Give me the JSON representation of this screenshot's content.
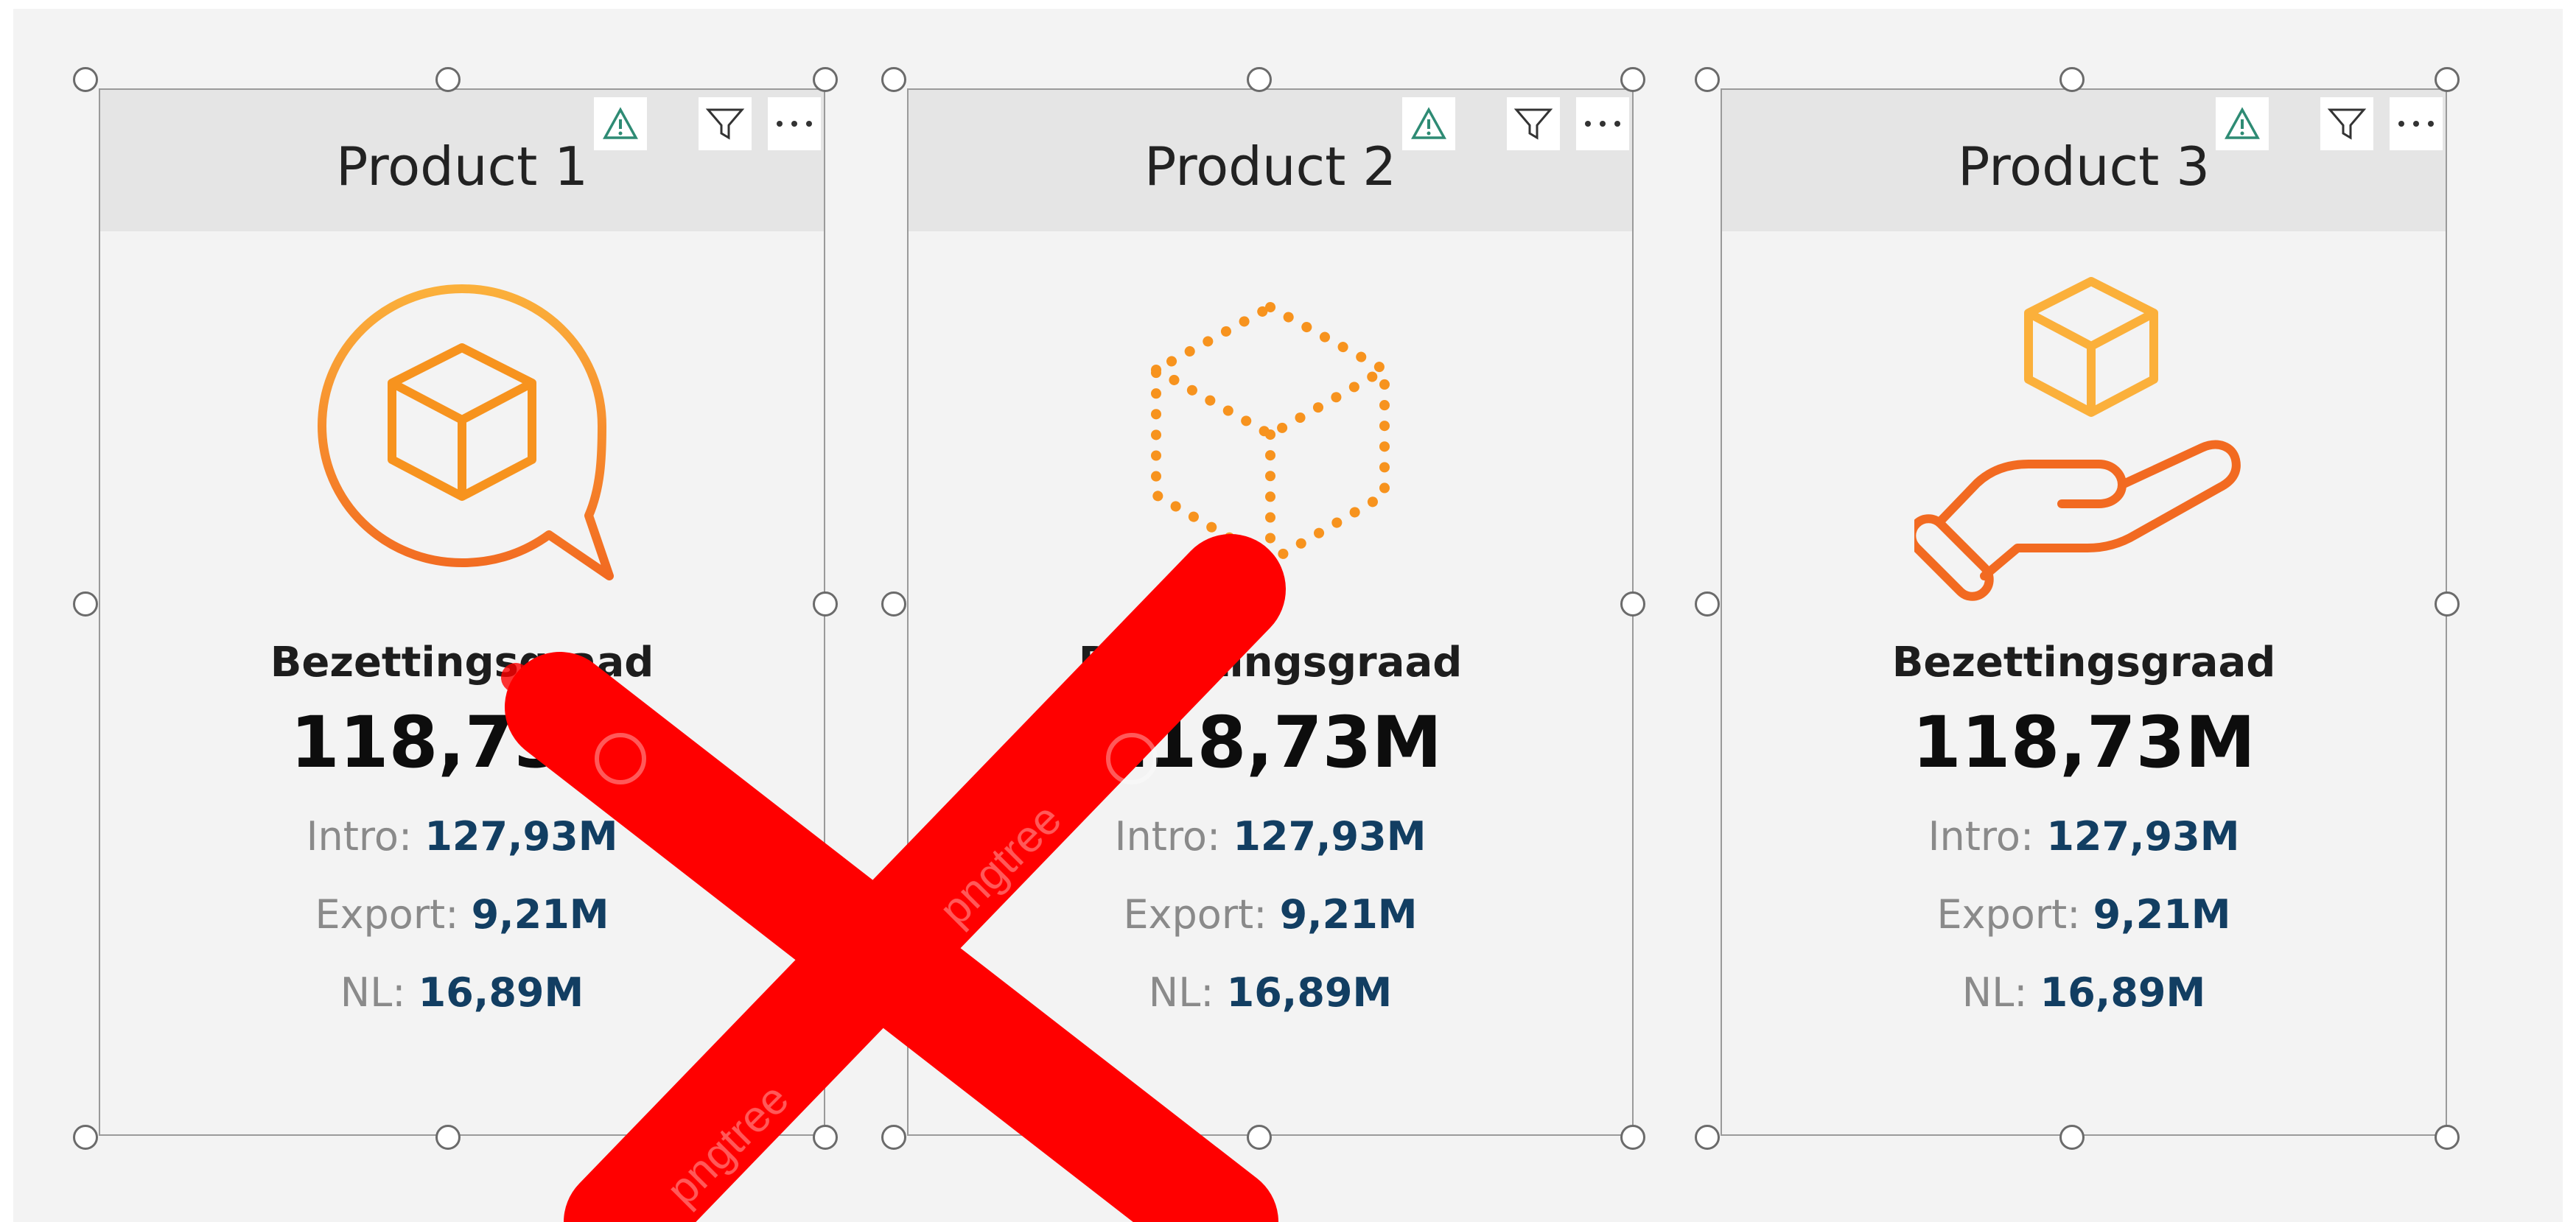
{
  "visuals": [
    {
      "title": "Product 1",
      "icon": "chat-bubble-cube-icon",
      "kpi_label": "Bezettingsgraad",
      "kpi_value": "118,73M",
      "rows": [
        {
          "label": "Intro:",
          "value": "127,93M"
        },
        {
          "label": "Export:",
          "value": "9,21M"
        },
        {
          "label": "NL:",
          "value": "16,89M"
        }
      ]
    },
    {
      "title": "Product 2",
      "icon": "dotted-cube-icon",
      "kpi_label": "Bezettingsgraad",
      "kpi_value": "118,73M",
      "rows": [
        {
          "label": "Intro:",
          "value": "127,93M"
        },
        {
          "label": "Export:",
          "value": "9,21M"
        },
        {
          "label": "NL:",
          "value": "16,89M"
        }
      ]
    },
    {
      "title": "Product 3",
      "icon": "hand-holding-cube-icon",
      "kpi_label": "Bezettingsgraad",
      "kpi_value": "118,73M",
      "rows": [
        {
          "label": "Intro:",
          "value": "127,93M"
        },
        {
          "label": "Export:",
          "value": "9,21M"
        },
        {
          "label": "NL:",
          "value": "16,89M"
        }
      ]
    }
  ],
  "header_buttons": [
    "warning-icon",
    "filter-icon",
    "more-options-icon"
  ],
  "overlay": {
    "icon": "red-x-cross-icon",
    "watermark": "pngtree"
  },
  "colors": {
    "accent_orange": "#f7931e",
    "accent_yellow": "#fbb03b",
    "accent_deep_orange": "#f26a21",
    "value_blue": "#123e62",
    "header_bg": "#e5e5e5",
    "canvas_bg": "#f3f3f3",
    "cross_red": "#ff0000",
    "warning_teal": "#2e8b74"
  }
}
